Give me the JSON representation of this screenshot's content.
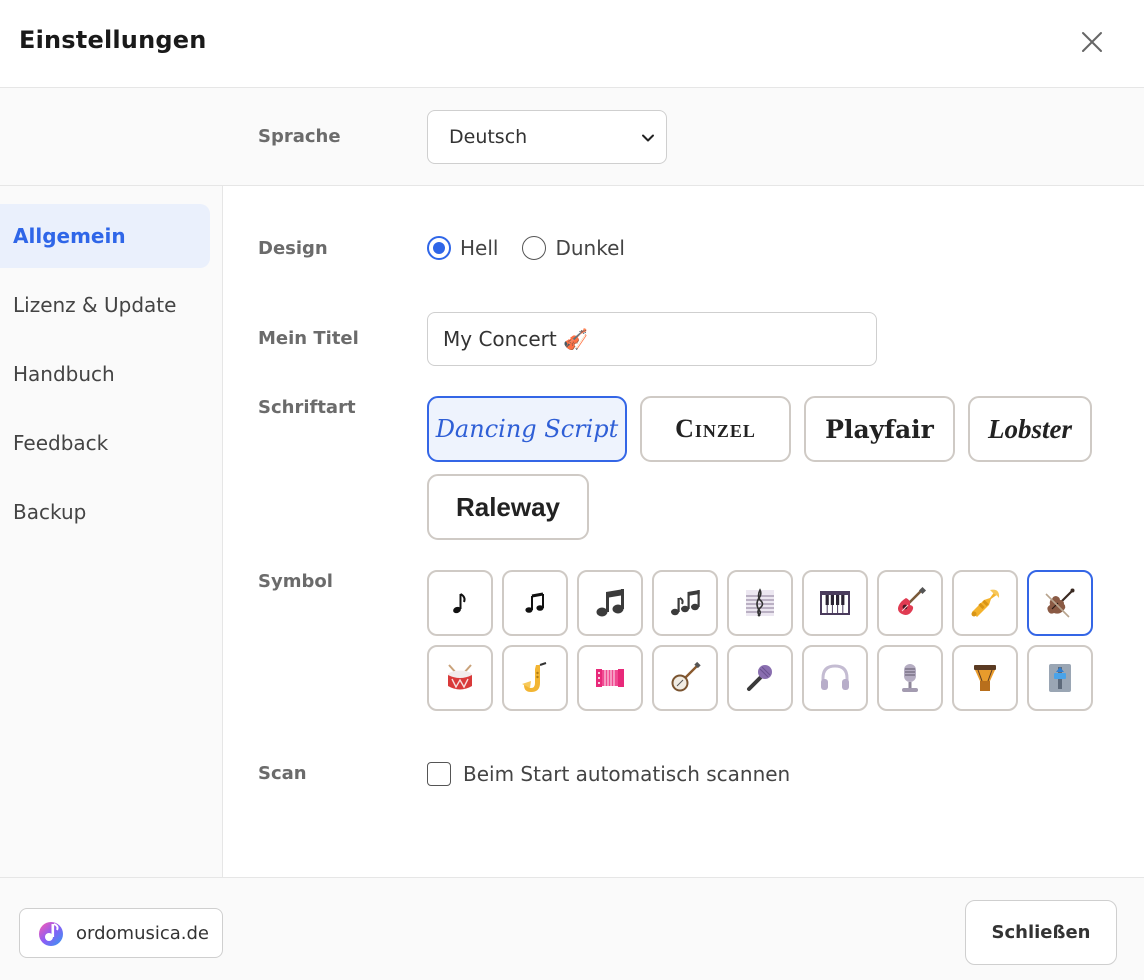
{
  "dialog": {
    "title": "Einstellungen",
    "close_icon": "close-icon"
  },
  "language": {
    "label": "Sprache",
    "selected": "Deutsch"
  },
  "sidebar": {
    "items": [
      {
        "label": "Allgemein",
        "active": true
      },
      {
        "label": "Lizenz & Update",
        "active": false
      },
      {
        "label": "Handbuch",
        "active": false
      },
      {
        "label": "Feedback",
        "active": false
      },
      {
        "label": "Backup",
        "active": false
      }
    ]
  },
  "design": {
    "label": "Design",
    "options": [
      {
        "label": "Hell",
        "checked": true
      },
      {
        "label": "Dunkel",
        "checked": false
      }
    ]
  },
  "my_title": {
    "label": "Mein Titel",
    "value": "My Concert 🎻"
  },
  "fonts": {
    "label": "Schriftart",
    "options": [
      {
        "label": "Dancing Script",
        "selected": true
      },
      {
        "label": "Cinzel",
        "selected": false
      },
      {
        "label": "Playfair",
        "selected": false
      },
      {
        "label": "Lobster",
        "selected": false
      },
      {
        "label": "Raleway",
        "selected": false
      }
    ]
  },
  "symbols": {
    "label": "Symbol",
    "selected": "violin",
    "items": [
      "eighth-note",
      "beamed-notes",
      "musical-note",
      "multiple-notes",
      "musical-score",
      "piano",
      "guitar",
      "trumpet",
      "violin",
      "drum",
      "saxophone",
      "accordion",
      "banjo",
      "microphone",
      "headphones",
      "studio-microphone",
      "long-drum",
      "level-slider"
    ]
  },
  "scan": {
    "label": "Scan",
    "checkbox_label": "Beim Start automatisch scannen",
    "checked": false
  },
  "footer": {
    "brand_label": "ordomusica.de",
    "close_label": "Schließen"
  },
  "colors": {
    "accent": "#2f66e8",
    "selected_bg": "#eef3fd",
    "border": "#cfcac5"
  }
}
